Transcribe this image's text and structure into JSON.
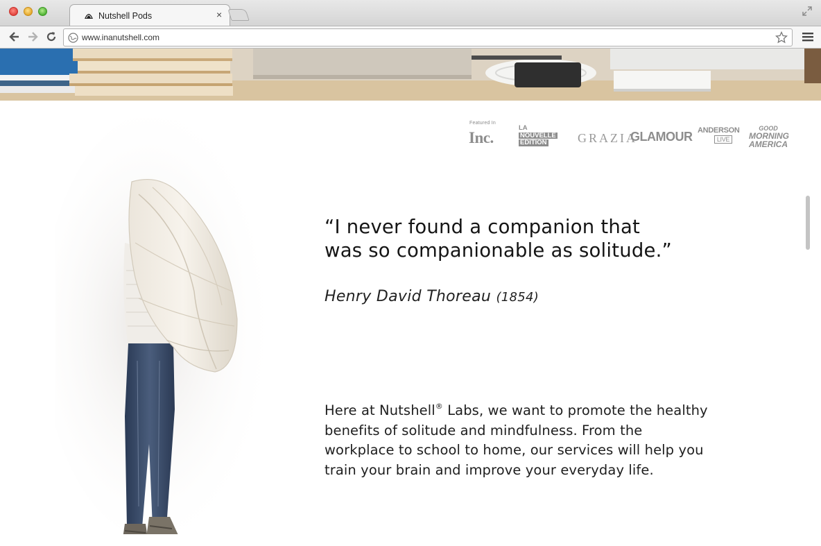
{
  "browser": {
    "tab_title": "Nutshell Pods",
    "tab_close": "×",
    "url": "www.inanutshell.com"
  },
  "page": {
    "featured": {
      "label": "Featured In",
      "logos": {
        "inc": "Inc.",
        "la_nouvelle_1": "LA",
        "la_nouvelle_2": "NOUVELLE",
        "la_nouvelle_3": "EDITION",
        "grazia": "GRAZIA",
        "glamour": "GLAMOUR",
        "anderson": "ANDERSON",
        "anderson_live": "LIVE",
        "gma_1": "GOOD",
        "gma_2": "MORNING",
        "gma_3": "AMERICA"
      }
    },
    "quote": {
      "line1": "“I never found a companion that",
      "line2": "was so companionable as solitude.”",
      "author": "Henry David Thoreau",
      "year": "(1854)"
    },
    "body": {
      "part1": "Here at Nutshell",
      "registered": "®",
      "part2": " Labs, we want to promote the healthy benefits of solitude and mindfulness. From the workplace to school to home, our services will help you train your brain and improve your everyday life."
    }
  }
}
